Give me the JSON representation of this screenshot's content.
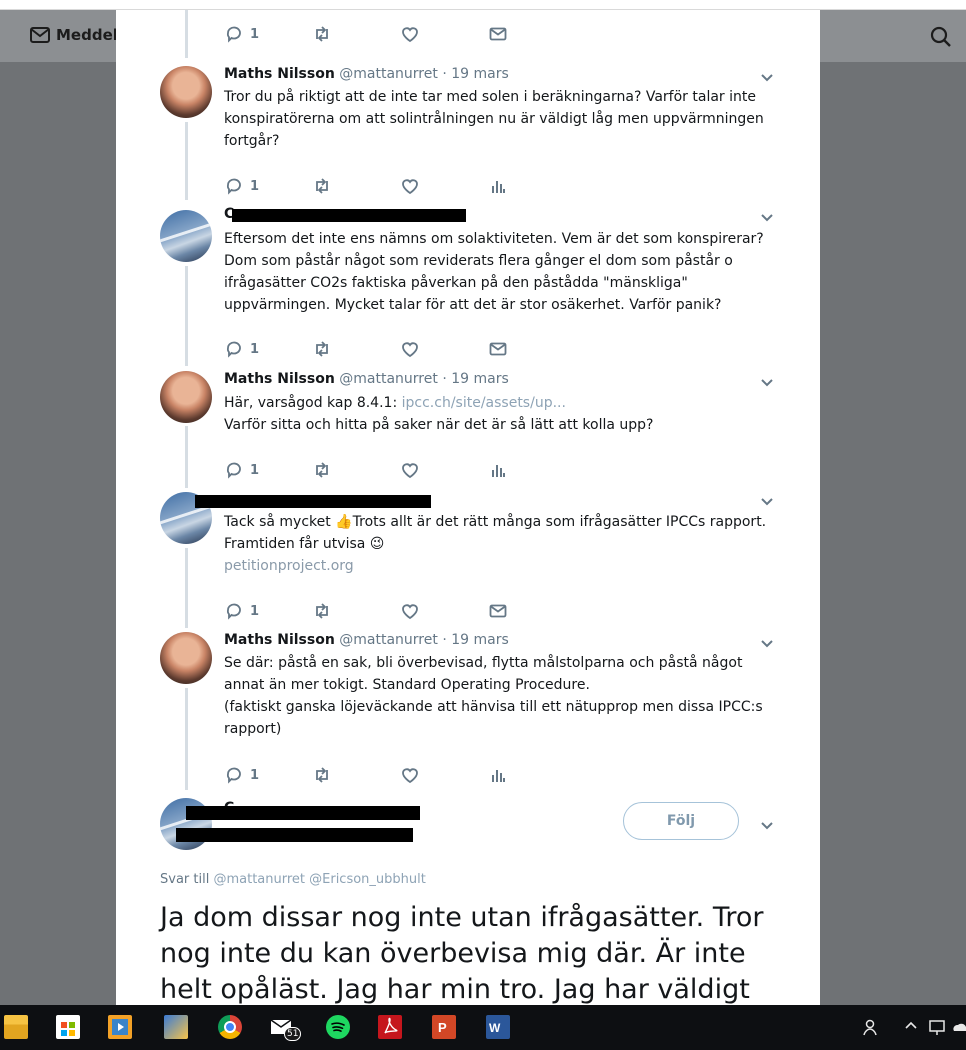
{
  "background": {
    "nav_label": "Meddela"
  },
  "tweets": [
    {
      "reply_count": "1",
      "action4_icon": "mail-icon"
    },
    {
      "name": "Maths Nilsson",
      "handle": "@mattanurret",
      "separator": "·",
      "date": "19 mars",
      "text": "Tror du på riktigt att de inte tar med solen i beräkningarna? Varför talar inte konspiratörerna om att solintrålningen nu är väldigt låg men uppvärmningen fortgår?",
      "reply_count": "1",
      "action4_icon": "analytics-icon"
    },
    {
      "name": "C",
      "text": "Eftersom det inte ens nämns om solaktiviteten. Vem är det som konspirerar? Dom som påstår något som reviderats flera gånger el dom som påstår o ifrågasätter CO2s faktiska påverkan på den påstådda \"mänskliga\" uppvärmingen. Mycket talar för att det är stor osäkerhet. Varför panik?",
      "reply_count": "1",
      "action4_icon": "mail-icon"
    },
    {
      "name": "Maths Nilsson",
      "handle": "@mattanurret",
      "separator": "·",
      "date": "19 mars",
      "text_before_link": "Här, varsågod kap 8.4.1:",
      "link": "ipcc.ch/site/assets/up...",
      "text_after": "Varför sitta och hitta på saker när det är så lätt att kolla upp?",
      "reply_count": "1",
      "action4_icon": "analytics-icon"
    },
    {
      "text_part1": "Tack så mycket",
      "emoji1": "👍",
      "text_part2": "Trots allt är det rätt många som ifrågasätter IPCCs rapport. Framtiden får utvisa",
      "emoji2": "😉",
      "link": "petitionproject.org",
      "reply_count": "1",
      "action4_icon": "mail-icon"
    },
    {
      "name": "Maths Nilsson",
      "handle": "@mattanurret",
      "separator": "·",
      "date": "19 mars",
      "text_line1": "Se där: påstå en sak, bli överbevisad, flytta målstolparna och påstå något annat än mer tokigt. Standard Operating Procedure.",
      "text_line2": "(faktiskt ganska löjeväckande att hänvisa till ett nätupprop men dissa IPCC:s rapport)",
      "reply_count": "1",
      "action4_icon": "analytics-icon"
    }
  ],
  "main_tweet": {
    "name": "C",
    "follow_label": "Följ",
    "reply_to_label": "Svar till",
    "reply_to_mentions": "@mattanurret @Ericson_ubbhult",
    "text": "Ja dom dissar nog inte utan ifrågasätter. Tror nog inte du kan överbevisa mig där. Är inte helt opåläst. Jag har min tro. Jag har väldigt"
  },
  "taskbar": {
    "mail_badge": "51",
    "icons": [
      "file-explorer-icon",
      "store-icon",
      "media-player-icon",
      "photos-icon",
      "chrome-icon",
      "mail-icon",
      "spotify-icon",
      "acrobat-icon",
      "powerpoint-icon",
      "word-icon"
    ],
    "tray": [
      "people-icon",
      "chevron-up-icon",
      "network-icon",
      "cloud-icon"
    ]
  },
  "colors": {
    "accent": "#1da1f2",
    "muted": "#657786",
    "link": "#8ea3b5",
    "thread_line": "#d6dde3"
  }
}
